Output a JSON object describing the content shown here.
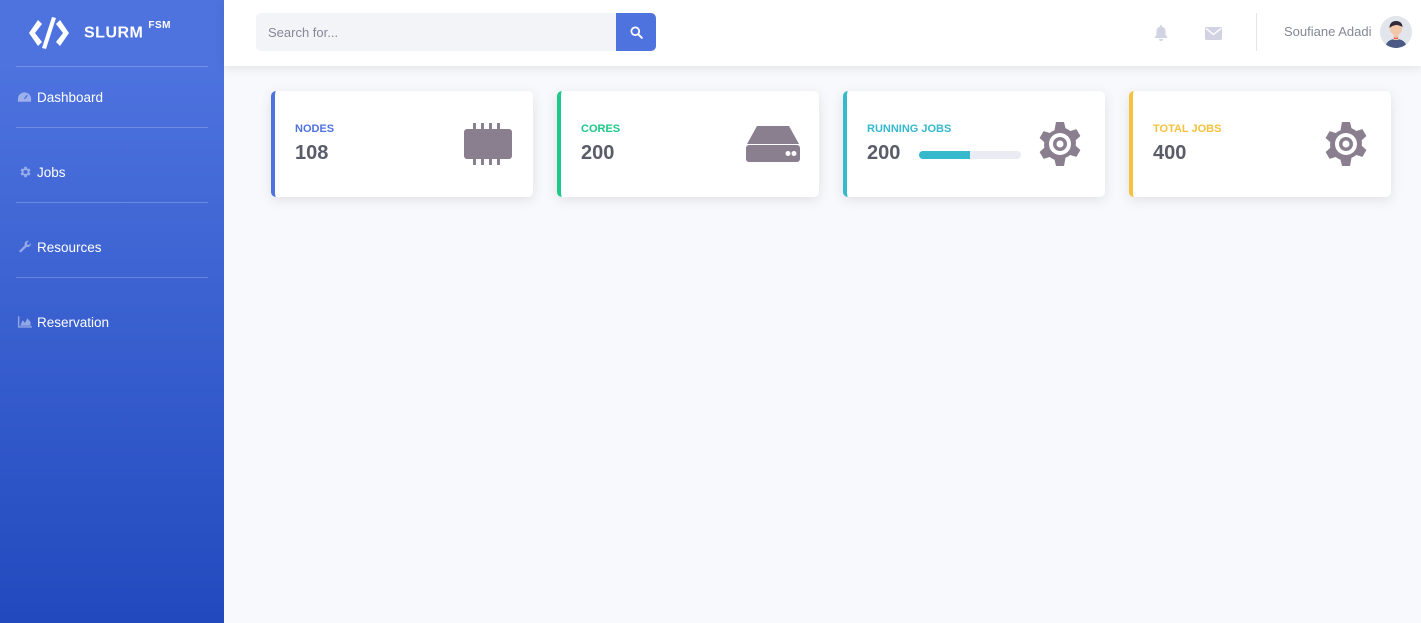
{
  "brand": {
    "name": "SLURM",
    "sup": "FSM"
  },
  "sidebar": {
    "items": [
      {
        "label": "Dashboard",
        "icon": "dashboard-icon"
      },
      {
        "label": "Jobs",
        "icon": "gear-icon"
      },
      {
        "label": "Resources",
        "icon": "wrench-icon"
      },
      {
        "label": "Reservation",
        "icon": "area-chart-icon"
      }
    ]
  },
  "search": {
    "placeholder": "Search for...",
    "value": ""
  },
  "topbar": {
    "user_name": "Soufiane Adadi"
  },
  "cards": [
    {
      "label": "NODES",
      "value": "108",
      "color": "#4e73df",
      "icon": "chip-icon"
    },
    {
      "label": "CORES",
      "value": "200",
      "color": "#1cc88a",
      "icon": "hard-drive-icon"
    },
    {
      "label": "RUNNING JOBS",
      "value": "200",
      "color": "#36b9cc",
      "icon": "gear-icon",
      "progress": 0.5
    },
    {
      "label": "TOTAL JOBS",
      "value": "400",
      "color": "#f6c23e",
      "icon": "gear-icon"
    }
  ],
  "colors": {
    "primary": "#4e73df",
    "icon_muted": "#8a7f8e"
  }
}
